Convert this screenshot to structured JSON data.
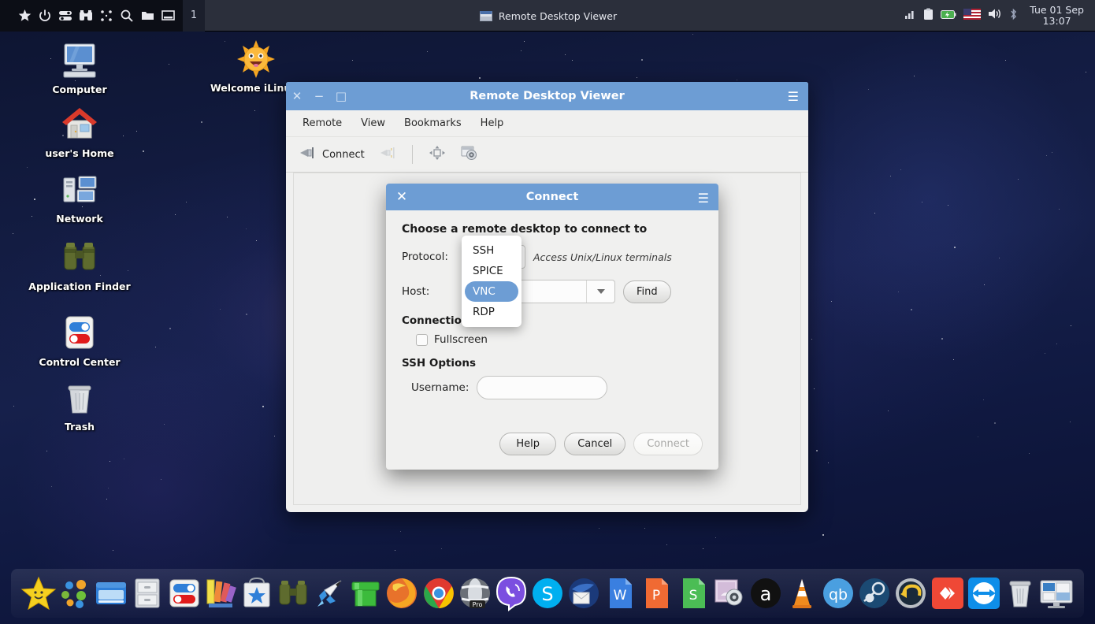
{
  "panel": {
    "launchers": [
      {
        "name": "star-icon",
        "glyph": "★"
      },
      {
        "name": "power-icon",
        "glyph": "⏻"
      },
      {
        "name": "settings-toggle-icon",
        "glyph": "◉"
      },
      {
        "name": "binoculars-icon",
        "glyph": "🔭"
      },
      {
        "name": "grid-icon",
        "glyph": "⣿"
      },
      {
        "name": "search-icon",
        "glyph": "🔍"
      },
      {
        "name": "folder-icon",
        "glyph": "📁"
      },
      {
        "name": "window-icon",
        "glyph": "🗔"
      }
    ],
    "workspace": "1",
    "task_title": "Remote Desktop Viewer",
    "tray": [
      "signal-icon",
      "clipboard-icon",
      "battery-icon",
      "flag-icon",
      "volume-icon",
      "bluetooth-icon"
    ],
    "clock_date": "Tue 01 Sep",
    "clock_time": "13:07"
  },
  "desktop_icons": [
    {
      "label": "Computer",
      "icon": "computer-icon"
    },
    {
      "label": "user's Home",
      "icon": "home-icon"
    },
    {
      "label": "Network",
      "icon": "network-icon"
    },
    {
      "label": "Application Finder",
      "icon": "binoculars-icon"
    },
    {
      "label": "Control Center",
      "icon": "control-center-icon"
    },
    {
      "label": "Trash",
      "icon": "trash-icon"
    },
    {
      "label": "Welcome iLinux!",
      "icon": "sun-icon"
    }
  ],
  "window": {
    "title": "Remote Desktop Viewer",
    "close": "✕",
    "minimize": "−",
    "maximize": "□",
    "hamburger": "☰",
    "menus": [
      "Remote",
      "View",
      "Bookmarks",
      "Help"
    ],
    "toolbar": {
      "connect_label": "Connect",
      "connect_icon": "plug-connect-icon",
      "disconnect_icon": "plug-disconnect-icon",
      "fullscreen_icon": "fullscreen-icon",
      "screenshot_icon": "camera-screenshot-icon"
    }
  },
  "dialog": {
    "title": "Connect",
    "close": "✕",
    "hamburger": "☰",
    "heading": "Choose a remote desktop to connect to",
    "protocol_label": "Protocol:",
    "protocol_value": "SSH",
    "protocol_hint": "Access Unix/Linux terminals",
    "protocol_options": [
      "SSH",
      "SPICE",
      "VNC",
      "RDP"
    ],
    "protocol_selected": "VNC",
    "host_label": "Host:",
    "host_value": "",
    "find_label": "Find",
    "connection_section": "Connection",
    "fullscreen_label": "Fullscreen",
    "fullscreen_checked": false,
    "ssh_section": "SSH Options",
    "username_label": "Username:",
    "username_value": "",
    "help_label": "Help",
    "cancel_label": "Cancel",
    "connect_label": "Connect",
    "connect_disabled": true
  },
  "dock": [
    {
      "name": "smiley-star-icon"
    },
    {
      "name": "colorful-dots-icon"
    },
    {
      "name": "window-manager-icon"
    },
    {
      "name": "file-cabinet-icon"
    },
    {
      "name": "control-center-icon"
    },
    {
      "name": "color-palette-icon"
    },
    {
      "name": "app-store-icon"
    },
    {
      "name": "binoculars-icon"
    },
    {
      "name": "rocket-icon"
    },
    {
      "name": "green-pipe-icon"
    },
    {
      "name": "firefox-icon"
    },
    {
      "name": "chrome-icon"
    },
    {
      "name": "opera-pro-icon"
    },
    {
      "name": "viber-icon"
    },
    {
      "name": "skype-icon"
    },
    {
      "name": "mail-icon"
    },
    {
      "name": "word-processor-icon"
    },
    {
      "name": "presentation-icon"
    },
    {
      "name": "spreadsheet-icon"
    },
    {
      "name": "screenshot-tool-icon"
    },
    {
      "name": "audacity-icon"
    },
    {
      "name": "vlc-icon"
    },
    {
      "name": "qbittorrent-icon"
    },
    {
      "name": "steam-icon"
    },
    {
      "name": "backup-restore-icon"
    },
    {
      "name": "anydesk-icon"
    },
    {
      "name": "teamviewer-icon"
    },
    {
      "name": "trash-icon"
    },
    {
      "name": "remote-desktop-viewer-icon"
    }
  ],
  "colors": {
    "titlebar_blue": "#6d9dd4",
    "panel_dark": "#2b2f3b",
    "window_bg": "#f0f0ef",
    "selection_blue": "#6d9dd4"
  }
}
